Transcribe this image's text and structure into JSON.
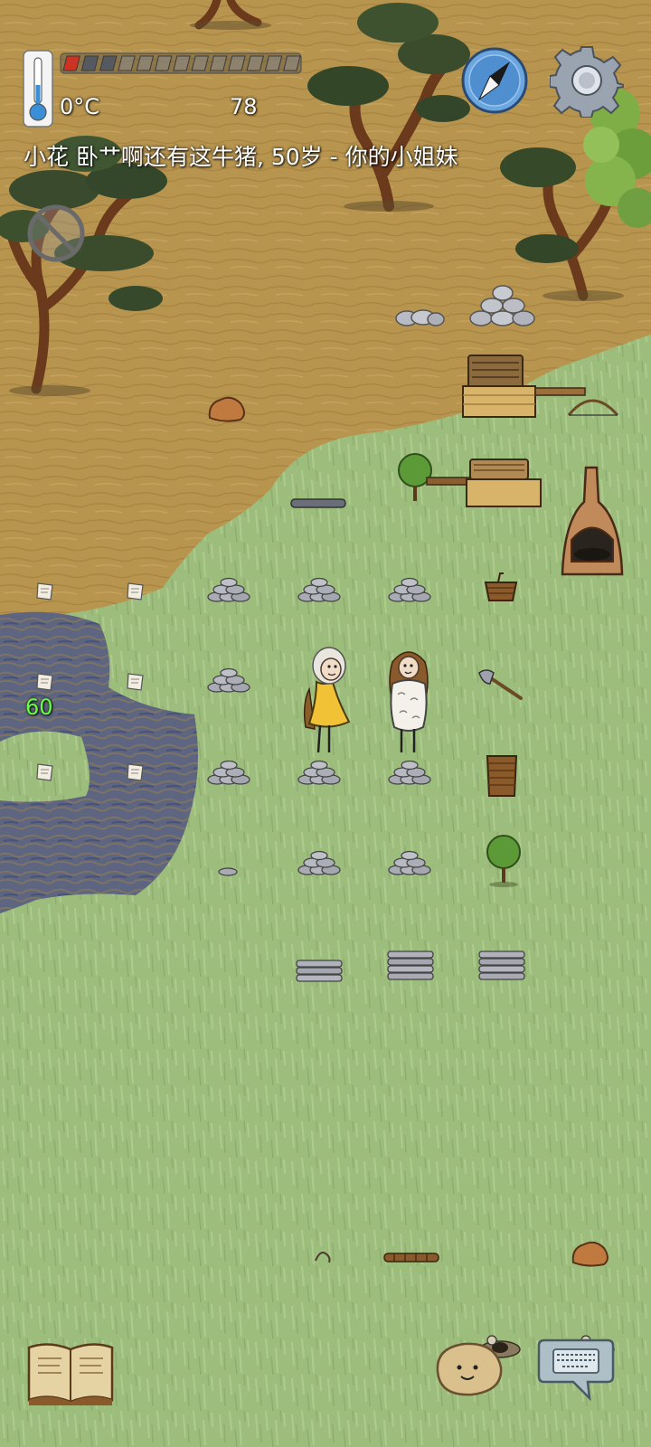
{
  "hud": {
    "temperature": "0°C",
    "food_value": "78",
    "speech": "小花 卧艹啊还有这牛猪, 50岁 - 你的小姐妹",
    "floating_number": "60",
    "food_pips_filled": 3,
    "food_pips_total": 13
  },
  "icons": {
    "thermometer": "thermometer-icon",
    "compass": "compass-icon",
    "settings": "gear-icon",
    "mute": "no-symbol-icon",
    "recipe_book": "book-icon",
    "emote": "potato-face-icon",
    "keyboard": "keyboard-icon"
  },
  "colors": {
    "savanna": "#b8954f",
    "grass": "#9fbf7f",
    "swamp": "#5a6a8a",
    "food_bar_fill": "#cc3322",
    "speech_text": "#ffffff",
    "floating_number": "#66ff44"
  }
}
